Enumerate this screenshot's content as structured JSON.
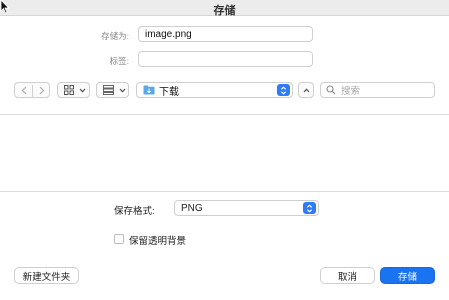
{
  "window": {
    "title": "存储"
  },
  "form": {
    "save_as_label": "存储为:",
    "save_as_value": "image.png",
    "tags_label": "标签:",
    "tags_value": ""
  },
  "toolbar": {
    "location": "下载",
    "search_placeholder": "搜索"
  },
  "options": {
    "format_label": "保存格式:",
    "format_value": "PNG",
    "keep_transparent_label": "保留透明背景",
    "keep_transparent_checked": false
  },
  "footer": {
    "new_folder_label": "新建文件夹",
    "cancel_label": "取消",
    "save_label": "存储"
  },
  "colors": {
    "accent": "#1a73f0",
    "stepper": "#2f7bf6",
    "folder": "#5aa8e8"
  }
}
